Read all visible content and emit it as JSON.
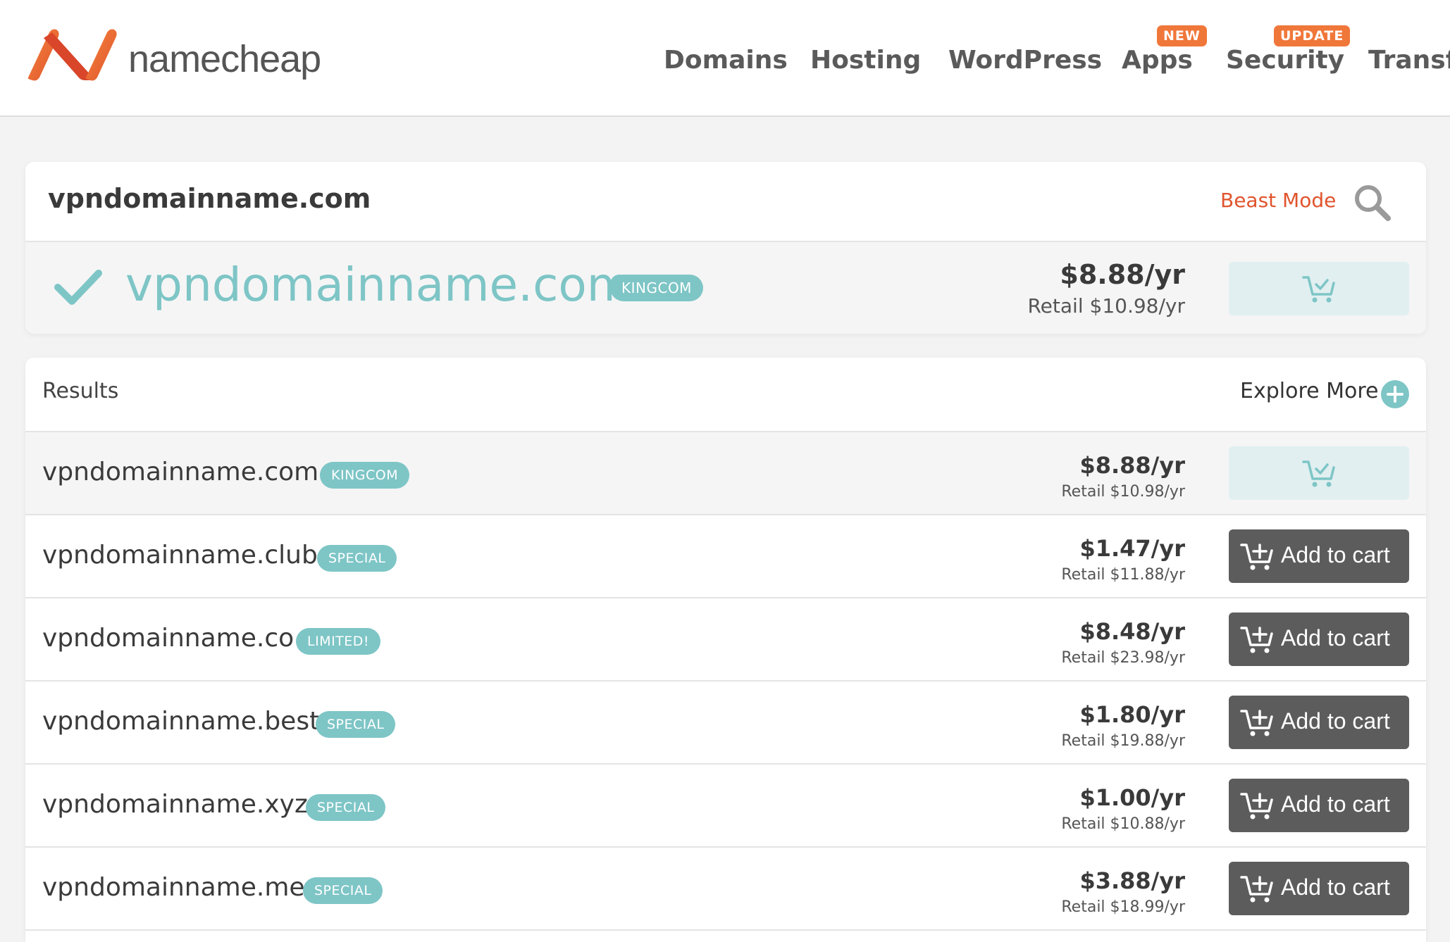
{
  "header": {
    "logo_text": "namecheap",
    "nav": [
      {
        "label": "Domains",
        "badge": null
      },
      {
        "label": "Hosting",
        "badge": null
      },
      {
        "label": "WordPress",
        "badge": null
      },
      {
        "label": "Apps",
        "badge": "NEW"
      },
      {
        "label": "Security",
        "badge": "UPDATE"
      },
      {
        "label": "Transfe",
        "badge": null
      }
    ]
  },
  "search": {
    "query": "vpndomainname.com",
    "beast_mode_label": "Beast Mode"
  },
  "featured": {
    "domain": "vpndomainname.com",
    "badge": "KINGCOM",
    "price": "$8.88/yr",
    "retail": "Retail $10.98/yr"
  },
  "results": {
    "title": "Results",
    "explore_more_label": "Explore More",
    "add_to_cart_label": "Add to cart",
    "rows": [
      {
        "domain": "vpndomainname.com",
        "badge": "KINGCOM",
        "price": "$8.88/yr",
        "retail": "Retail $10.98/yr",
        "in_cart": true
      },
      {
        "domain": "vpndomainname.club",
        "badge": "SPECIAL",
        "price": "$1.47/yr",
        "retail": "Retail $11.88/yr",
        "in_cart": false
      },
      {
        "domain": "vpndomainname.co",
        "badge": "LIMITED!",
        "price": "$8.48/yr",
        "retail": "Retail $23.98/yr",
        "in_cart": false
      },
      {
        "domain": "vpndomainname.best",
        "badge": "SPECIAL",
        "price": "$1.80/yr",
        "retail": "Retail $19.88/yr",
        "in_cart": false
      },
      {
        "domain": "vpndomainname.xyz",
        "badge": "SPECIAL",
        "price": "$1.00/yr",
        "retail": "Retail $10.88/yr",
        "in_cart": false
      },
      {
        "domain": "vpndomainname.me",
        "badge": "SPECIAL",
        "price": "$3.88/yr",
        "retail": "Retail $18.99/yr",
        "in_cart": false
      }
    ]
  },
  "colors": {
    "brand_orange": "#f0773a",
    "accent_teal": "#7ec5c6",
    "beast_mode_red": "#e0542d",
    "button_dark": "#5c5c5c",
    "button_in_cart": "#e1eff0"
  },
  "icons": {
    "logo": "namecheap-logo-icon",
    "search": "search-icon",
    "available": "check-icon",
    "explore": "plus-circle-icon",
    "in_cart": "cart-check-icon",
    "add": "cart-add-icon"
  }
}
